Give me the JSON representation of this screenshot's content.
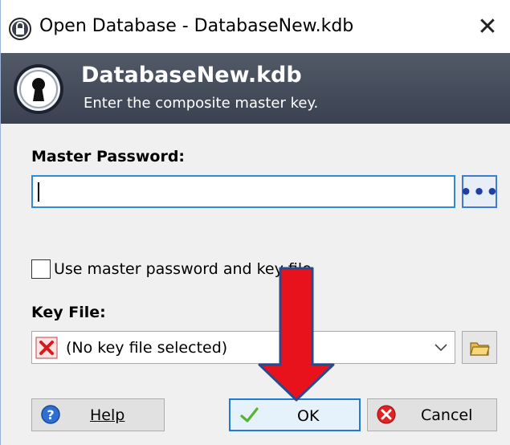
{
  "window": {
    "title": "Open Database - DatabaseNew.kdb",
    "close_glyph": "✕"
  },
  "banner": {
    "title": "DatabaseNew.kdb",
    "subtitle": "Enter the composite master key."
  },
  "master_password": {
    "label": "Master Password:",
    "value": "",
    "reveal_glyph": "•••"
  },
  "options": {
    "use_password_and_keyfile_label": "Use master password and key file",
    "checked": false
  },
  "key_file": {
    "label": "Key File:",
    "selected": "(No key file selected)"
  },
  "buttons": {
    "help": "Help",
    "ok": "OK",
    "cancel": "Cancel"
  },
  "colors": {
    "banner_bg": "#454c5a",
    "focus_blue": "#2f8ad8",
    "annotation_arrow": "#e8121d",
    "annotation_outline": "#2b4a8c"
  },
  "icons": {
    "title": "lock-icon",
    "banner": "keyhole-icon",
    "reveal": "dots-icon",
    "key_file_state": "red-x-icon",
    "browse": "folder-icon",
    "help": "question-icon",
    "ok": "checkmark-icon",
    "cancel": "cancel-icon"
  }
}
